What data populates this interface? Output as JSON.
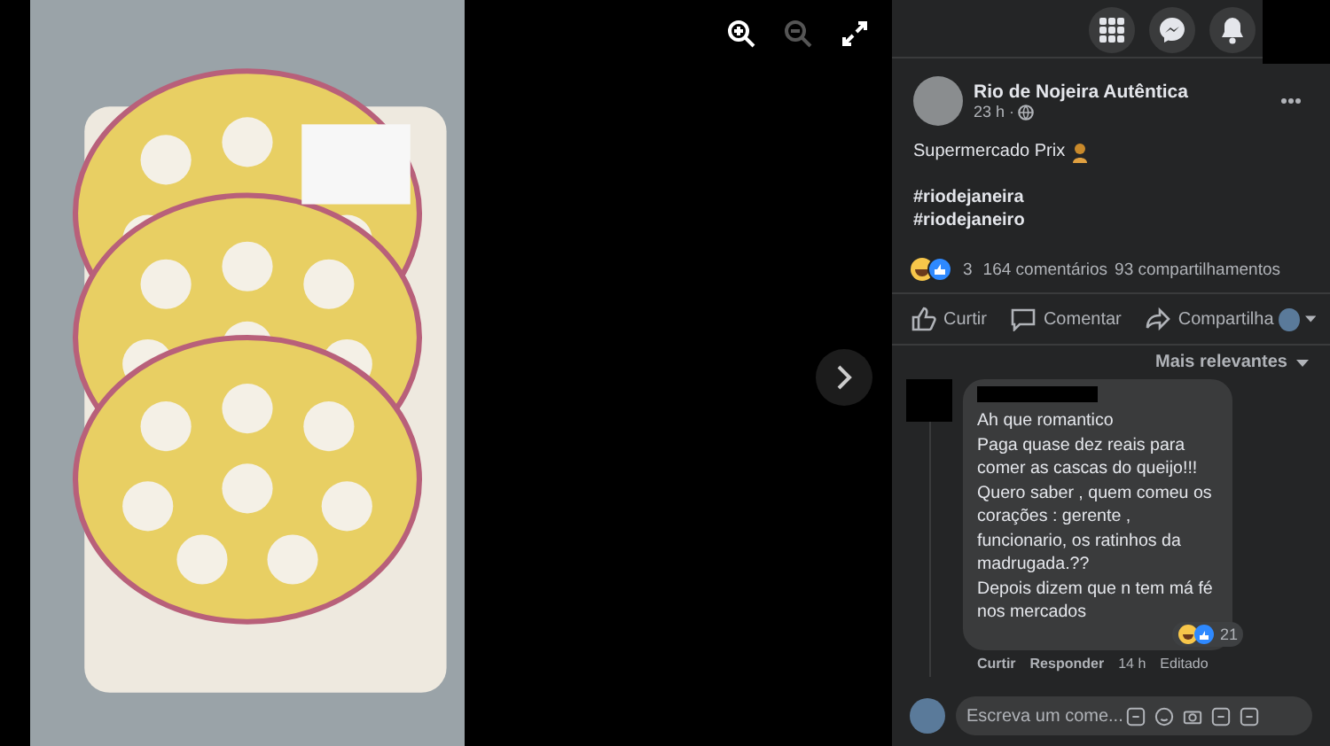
{
  "viewer": {
    "controls": [
      {
        "kind": "zoom-in",
        "disabled": false
      },
      {
        "kind": "zoom-out",
        "disabled": true
      },
      {
        "kind": "fullscreen",
        "disabled": false
      }
    ]
  },
  "post": {
    "author": "Rio de Nojeira Autêntica",
    "time": "23 h ·",
    "text": "Supermercado Prix",
    "hashtags": [
      "#riodejaneira",
      "#riodejaneiro"
    ],
    "reactions_count": "3",
    "comments_count": "164 comentários",
    "shares_count": "93 compartilhamentos",
    "actions": [
      {
        "kind": "like",
        "label": "Curtir"
      },
      {
        "kind": "comment",
        "label": "Comentar"
      },
      {
        "kind": "share",
        "label": "Compartilha"
      }
    ],
    "sort": "Mais relevantes"
  },
  "comment": {
    "text": "Ah que romantico\nPaga quase dez reais para comer as cascas do queijo!!!\nQuero saber , quem comeu os corações : gerente , funcionario, os ratinhos da madrugada.??\nDepois dizem que n tem má fé nos mercados",
    "reactions_count": "21",
    "actions": [
      "Curtir",
      "Responder"
    ],
    "time": "14 h",
    "edited": "Editado"
  },
  "composer": {
    "placeholder": "Escreva um come..."
  }
}
